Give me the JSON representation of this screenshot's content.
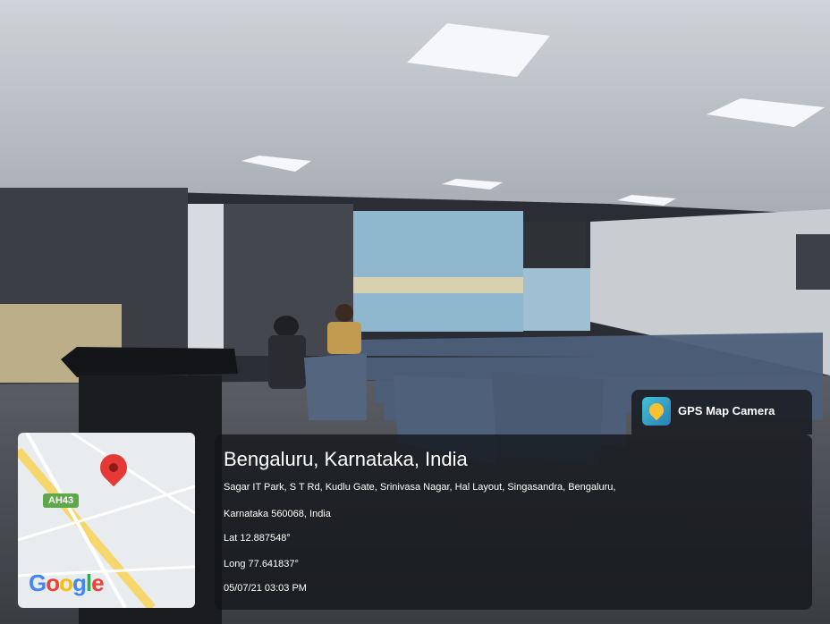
{
  "gps_tab": {
    "label": "GPS Map Camera",
    "icon": "gps-map-camera-app-icon"
  },
  "location": {
    "title": "Bengaluru, Karnataka, India",
    "address_line1": "Sagar IT Park, S T Rd, Kudlu Gate, Srinivasa Nagar, Hal Layout, Singasandra, Bengaluru,",
    "address_line2": "Karnataka 560068, India",
    "lat": "Lat 12.887548°",
    "long": "Long 77.641837°",
    "datetime": "05/07/21 03:03 PM"
  },
  "map": {
    "highway_badge": "AH43",
    "provider": "Google"
  },
  "colors": {
    "overlay_bg": "#121418",
    "pin": "#e53935",
    "badge": "#5fa84a"
  }
}
